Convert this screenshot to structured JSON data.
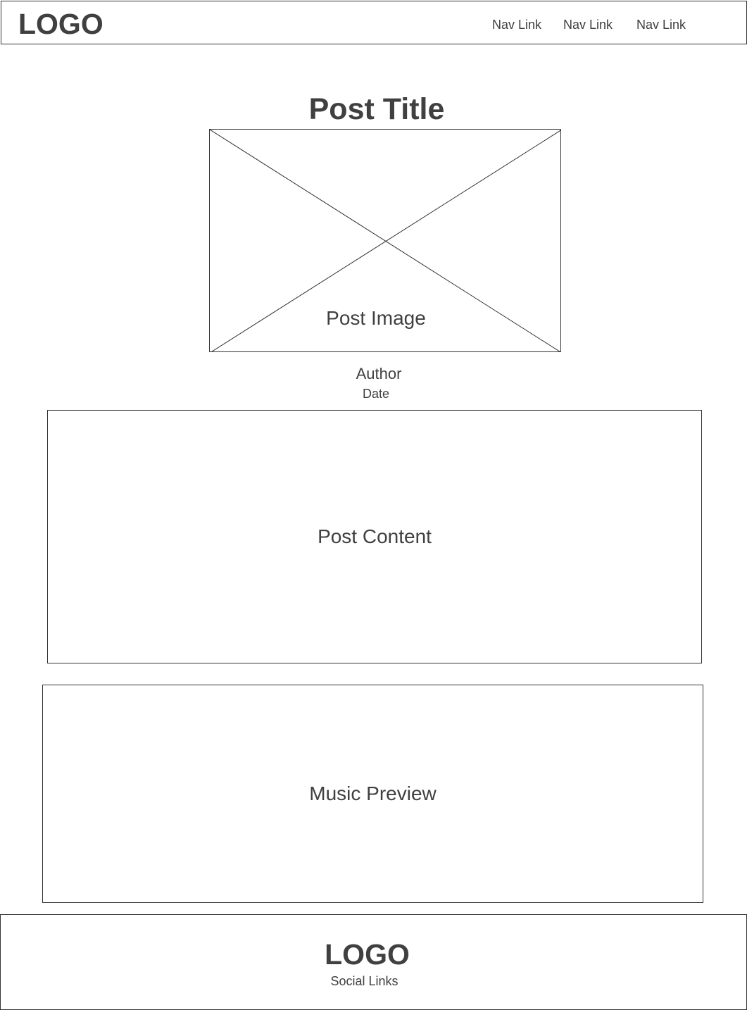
{
  "header": {
    "logo": "LOGO",
    "nav_links": [
      "Nav Link",
      "Nav Link",
      "Nav Link"
    ]
  },
  "post": {
    "title": "Post Title",
    "image_label": "Post Image",
    "author": "Author",
    "date": "Date",
    "content_label": "Post Content"
  },
  "music": {
    "label": "Music Preview"
  },
  "footer": {
    "logo": "LOGO",
    "social_links": "Social Links"
  }
}
